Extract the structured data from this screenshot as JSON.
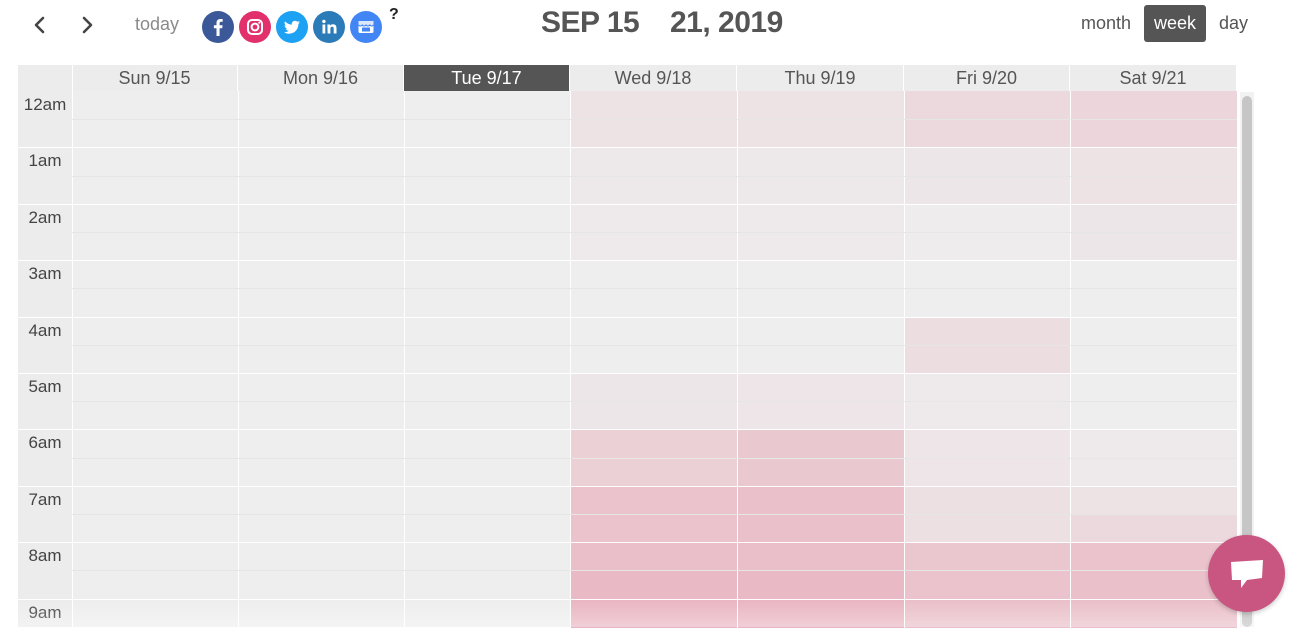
{
  "toolbar": {
    "today_label": "today",
    "help_label": "?",
    "date_start": "SEP 15",
    "date_end": "21, 2019",
    "views": {
      "month": "month",
      "week": "week",
      "day": "day"
    },
    "active_view": "week",
    "social": [
      {
        "name": "facebook",
        "icon": "facebook-icon",
        "color": "#3b5998"
      },
      {
        "name": "instagram",
        "icon": "instagram-icon",
        "color": "#e1306c"
      },
      {
        "name": "twitter",
        "icon": "twitter-icon",
        "color": "#1da1f2"
      },
      {
        "name": "linkedin",
        "icon": "linkedin-icon",
        "color": "#2b7bb9"
      },
      {
        "name": "google-my-business",
        "icon": "storefront-icon",
        "color": "#4285f4"
      }
    ]
  },
  "calendar": {
    "days": [
      "Sun 9/15",
      "Mon 9/16",
      "Tue 9/17",
      "Wed 9/18",
      "Thu 9/19",
      "Fri 9/20",
      "Sat 9/21"
    ],
    "today_index": 2,
    "hours": [
      "12am",
      "1am",
      "2am",
      "3am",
      "4am",
      "5am",
      "6am",
      "7am",
      "8am",
      "9am"
    ],
    "heat_color": "#e58fa4",
    "base_color": "#eeeeee",
    "heatmap_note": "intensity (0-1) per half-hour slot, rows = slots starting 12am, columns = Sun..Sat",
    "intensity": [
      [
        0,
        0,
        0,
        0.12,
        0.12,
        0.22,
        0.25
      ],
      [
        0,
        0,
        0,
        0.12,
        0.12,
        0.22,
        0.25
      ],
      [
        0,
        0,
        0,
        0.06,
        0.06,
        0.08,
        0.12
      ],
      [
        0,
        0,
        0,
        0.06,
        0.06,
        0.08,
        0.12
      ],
      [
        0,
        0,
        0,
        0.05,
        0.05,
        0.02,
        0.08
      ],
      [
        0,
        0,
        0,
        0.05,
        0.05,
        0.02,
        0.08
      ],
      [
        0,
        0,
        0,
        0,
        0,
        0,
        0
      ],
      [
        0,
        0,
        0,
        0,
        0,
        0,
        0
      ],
      [
        0,
        0,
        0,
        0,
        0,
        0.18,
        0
      ],
      [
        0,
        0,
        0,
        0,
        0,
        0.18,
        0
      ],
      [
        0,
        0,
        0,
        0.08,
        0.1,
        0.05,
        0
      ],
      [
        0,
        0,
        0,
        0.08,
        0.1,
        0.05,
        0
      ],
      [
        0,
        0,
        0,
        0.32,
        0.4,
        0.1,
        0.05
      ],
      [
        0,
        0,
        0,
        0.32,
        0.4,
        0.1,
        0.05
      ],
      [
        0,
        0,
        0,
        0.45,
        0.48,
        0.15,
        0.12
      ],
      [
        0,
        0,
        0,
        0.45,
        0.48,
        0.15,
        0.22
      ],
      [
        0,
        0,
        0,
        0.5,
        0.5,
        0.42,
        0.45
      ],
      [
        0,
        0,
        0,
        0.55,
        0.55,
        0.45,
        0.48
      ],
      [
        0,
        0,
        0,
        0.6,
        0.6,
        0.5,
        0.5
      ]
    ]
  },
  "chat": {
    "icon": "chat-bubble-icon",
    "color": "#c95681"
  }
}
